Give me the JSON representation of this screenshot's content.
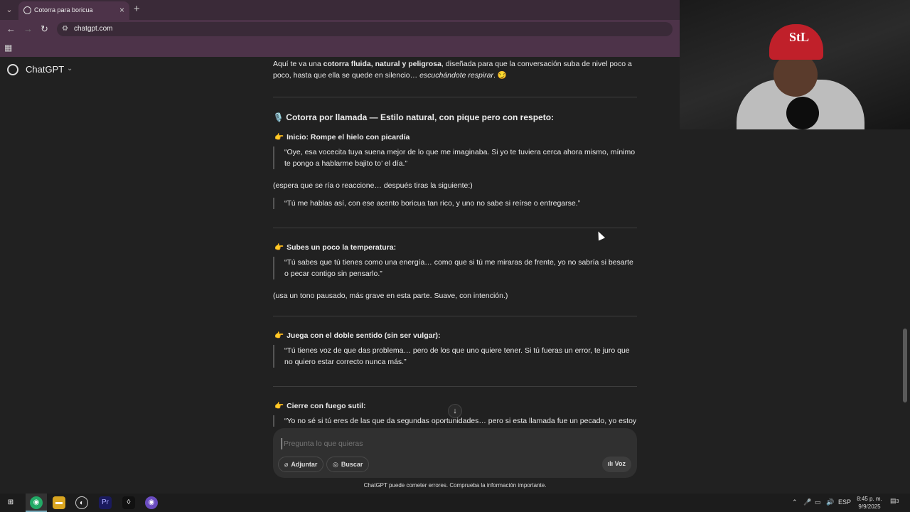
{
  "browser": {
    "tab_title": "Cotorra para boricua",
    "url": "chatgpt.com"
  },
  "sidebar": {
    "brand": "ChatGPT"
  },
  "chat": {
    "intro_pre": "Aquí te va una ",
    "intro_bold": "cotorra fluida, natural y peligrosa",
    "intro_mid": ", diseñada para que la conversación suba de nivel poco a poco, hasta que ella se quede en silencio… ",
    "intro_italic": "escuchándote respirar",
    "intro_post": ". 😏",
    "heading_icon": "🎙️",
    "heading": "Cotorra por llamada — Estilo natural, con pique pero con respeto:",
    "hand_icon": "👉",
    "sections": [
      {
        "title": "Inicio: Rompe el hielo con picardía",
        "quote1": "“Oye, esa vocecita tuya suena mejor de lo que me imaginaba. Si yo te tuviera cerca ahora mismo, mínimo te pongo a hablarme bajito to’ el día.”",
        "note": "(espera que se ría o reaccione… después tiras la siguiente:)",
        "quote2": "“Tú me hablas así, con ese acento boricua tan rico, y uno no sabe si reírse o entregarse.”"
      },
      {
        "title": "Subes un poco la temperatura:",
        "quote1": "“Tú sabes que tú tienes como una energía… como que si tú me miraras de frente, yo no sabría si besarte o pecar contigo sin pensarlo.”",
        "note": "(usa un tono pausado, más grave en esta parte. Suave, con intención.)"
      },
      {
        "title": "Juega con el doble sentido (sin ser vulgar):",
        "quote1": "“Tú tienes voz de que das problema… pero de los que uno quiere tener. Si tú fueras un error, te juro que no quiero estar correcto nunca más.”"
      },
      {
        "title": "Cierre con fuego sutil:",
        "quote1": "“Yo no sé si tú eres de las que da segundas oportunidades… pero si esta llamada fue un pecado, yo estoy"
      }
    ]
  },
  "composer": {
    "placeholder": "Pregunta lo que quieras",
    "attach_label": "Adjuntar",
    "search_label": "Buscar",
    "voice_label": "Voz"
  },
  "disclaimer": "ChatGPT puede cometer errores. Comprueba la información importante.",
  "taskbar": {
    "language": "ESP",
    "time": "8:45 p. m.",
    "date": "9/9/2025",
    "notifications": "3"
  },
  "webcam": {
    "cap_logo": "StL"
  }
}
